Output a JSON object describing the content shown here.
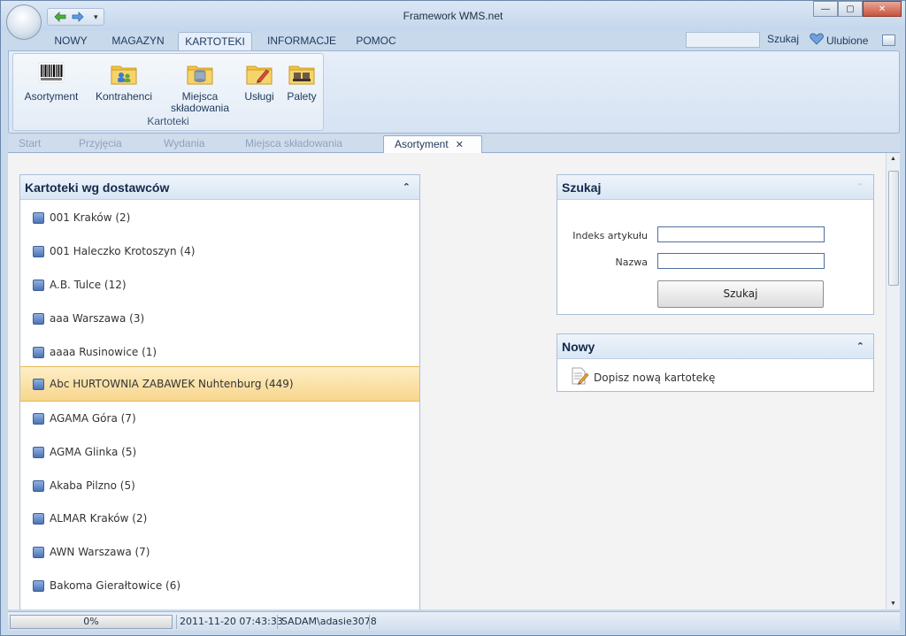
{
  "window": {
    "title": "Framework WMS.net"
  },
  "ribbon": {
    "tabs": [
      {
        "label": "NOWY"
      },
      {
        "label": "MAGAZYN"
      },
      {
        "label": "KARTOTEKI",
        "active": true
      },
      {
        "label": "INFORMACJE"
      },
      {
        "label": "POMOC"
      }
    ],
    "search_value": "",
    "search_label": "Szukaj",
    "favorites_label": "Ulubione",
    "group": {
      "label": "Kartoteki",
      "buttons": [
        {
          "label": "Asortyment",
          "icon": "barcode-icon"
        },
        {
          "label": "Kontrahenci",
          "icon": "contacts-folder-icon"
        },
        {
          "label_line1": "Miejsca",
          "label_line2": "składowania",
          "icon": "storage-folder-icon"
        },
        {
          "label": "Usługi",
          "icon": "services-folder-icon"
        },
        {
          "label": "Palety",
          "icon": "pallets-folder-icon"
        }
      ]
    }
  },
  "doc_tabs": [
    {
      "label": "Start"
    },
    {
      "label": "Przyjęcia"
    },
    {
      "label": "Wydania"
    },
    {
      "label": "Miejsca składowania"
    },
    {
      "label": "Asortyment",
      "active": true
    }
  ],
  "suppliers_panel": {
    "title": "Kartoteki wg dostawców",
    "items": [
      {
        "label": "001 Kraków (2)"
      },
      {
        "label": "001 Haleczko Krotoszyn (4)"
      },
      {
        "label": "A.B. Tulce (12)"
      },
      {
        "label": "aaa Warszawa (3)"
      },
      {
        "label": "aaaa Rusinowice (1)"
      },
      {
        "label": "Abc HURTOWNIA ZABAWEK Nuhtenburg (449)",
        "selected": true
      },
      {
        "label": "AGAMA Góra (7)"
      },
      {
        "label": "AGMA Glinka (5)"
      },
      {
        "label": "Akaba Pilzno (5)"
      },
      {
        "label": "ALMAR Kraków (2)"
      },
      {
        "label": "AWN Warszawa (7)"
      },
      {
        "label": "Bakoma Gierałtowice (6)"
      }
    ]
  },
  "search_panel": {
    "title": "Szukaj",
    "index_label": "Indeks artykułu",
    "index_value": "",
    "name_label": "Nazwa",
    "name_value": "",
    "button_label": "Szukaj"
  },
  "new_panel": {
    "title": "Nowy",
    "link_label": "Dopisz nową kartotekę"
  },
  "statusbar": {
    "progress_label": "0%",
    "progress_fraction": 0,
    "datetime": "2011-11-20 07:43:33",
    "user": "SADAM\\adasie3078"
  },
  "colors": {
    "accent": "#1e395b",
    "selection": "#f8d68d",
    "panel_border": "#a9bfd8"
  }
}
